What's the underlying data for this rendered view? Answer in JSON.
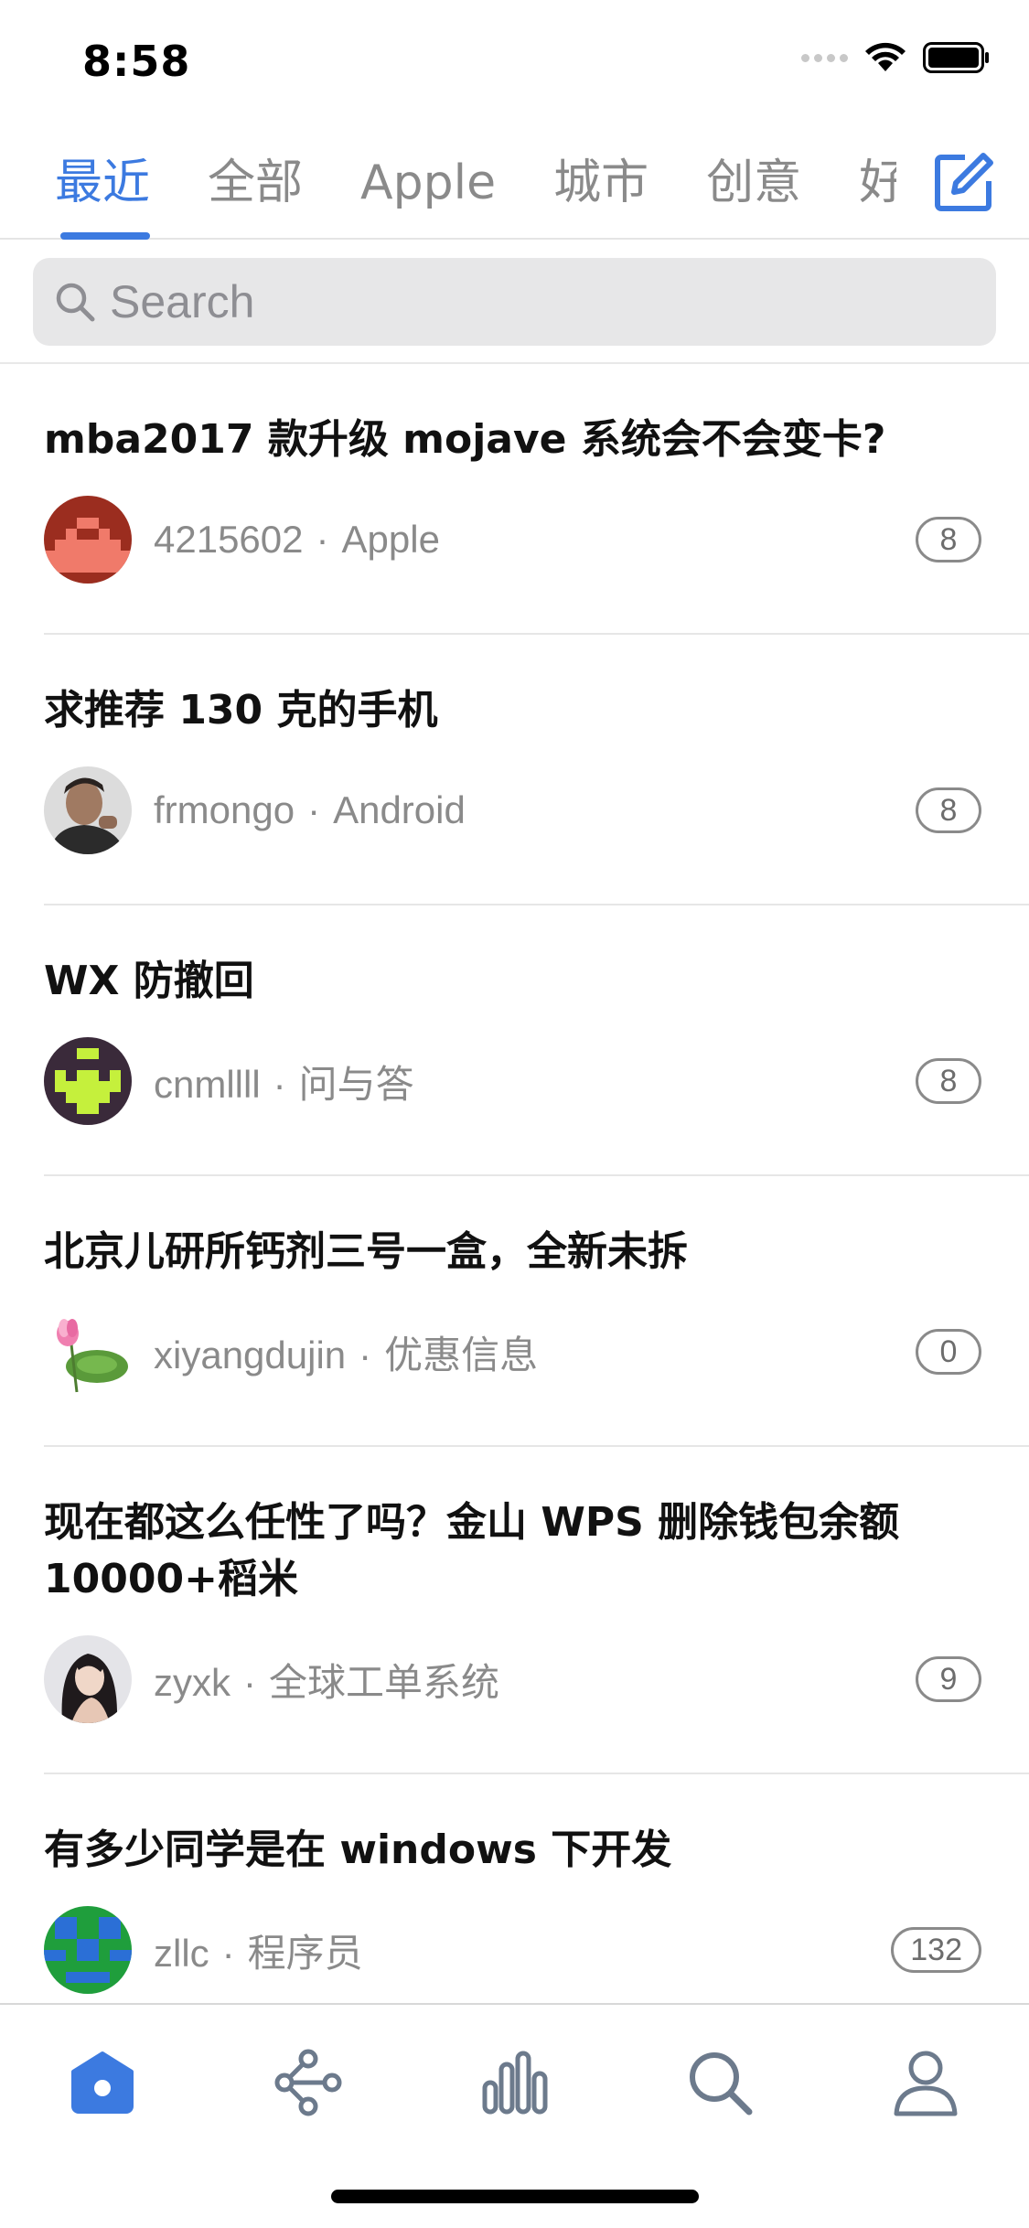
{
  "status_bar": {
    "time": "8:58"
  },
  "tabs": [
    {
      "label": "最近",
      "active": true
    },
    {
      "label": "全部",
      "active": false
    },
    {
      "label": "Apple",
      "active": false
    },
    {
      "label": "城市",
      "active": false
    },
    {
      "label": "创意",
      "active": false
    },
    {
      "label": "好玩",
      "active": false
    }
  ],
  "search": {
    "placeholder": "Search"
  },
  "topics": [
    {
      "title": "mba2017 款升级 mojave 系统会不会变卡?",
      "author": "4215602",
      "node": "Apple",
      "replies": "8",
      "avatar": "pixel-red-avatar"
    },
    {
      "title": "求推荐 130 克的手机",
      "author": "frmongo",
      "node": "Android",
      "replies": "8",
      "avatar": "photo-man-avatar"
    },
    {
      "title": "WX 防撤回",
      "author": "cnmllll",
      "node": "问与答",
      "replies": "8",
      "avatar": "pixel-lime-avatar"
    },
    {
      "title": "北京儿研所钙剂三号一盒，全新未拆",
      "author": "xiyangdujin",
      "node": "优惠信息",
      "replies": "0",
      "avatar": "lotus-avatar"
    },
    {
      "title": "现在都这么任性了吗？金山 WPS 删除钱包余额 10000+稻米",
      "author": "zyxk",
      "node": "全球工单系统",
      "replies": "9",
      "avatar": "photo-woman-avatar"
    },
    {
      "title": "有多少同学是在 windows 下开发",
      "author": "zllc",
      "node": "程序员",
      "replies": "132",
      "avatar": "pixel-green-avatar"
    }
  ],
  "tabbar": {
    "items": [
      {
        "icon": "home-icon",
        "active": true
      },
      {
        "icon": "share-nodes-icon",
        "active": false
      },
      {
        "icon": "bar-chart-icon",
        "active": false
      },
      {
        "icon": "search-icon",
        "active": false
      },
      {
        "icon": "profile-icon",
        "active": false
      }
    ],
    "accent": "#3c7ae0",
    "inactive": "#6c7a8c"
  },
  "colors": {
    "accent": "#3c7ae0",
    "meta": "#8a8a8a"
  }
}
